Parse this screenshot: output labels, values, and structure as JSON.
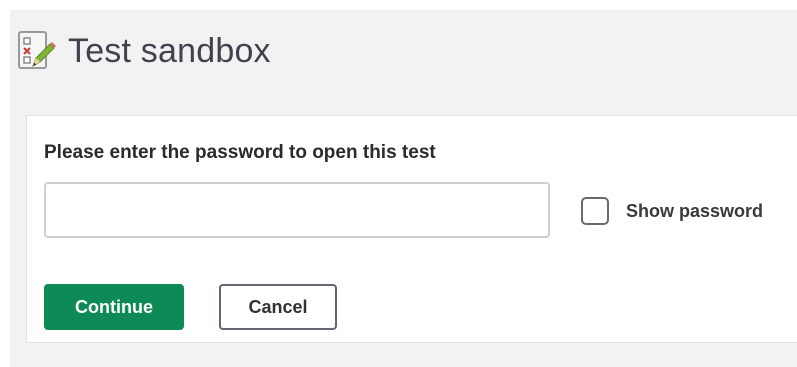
{
  "header": {
    "title": "Test sandbox",
    "icon": "test-checklist-pencil-icon"
  },
  "form": {
    "prompt": "Please enter the password to open this test",
    "password_value": "",
    "show_password_label": "Show password",
    "show_password_checked": false,
    "continue_label": "Continue",
    "cancel_label": "Cancel"
  },
  "colors": {
    "primary": "#0d8a55",
    "title_text": "#44404e",
    "page_background": "#f2f2f2"
  }
}
